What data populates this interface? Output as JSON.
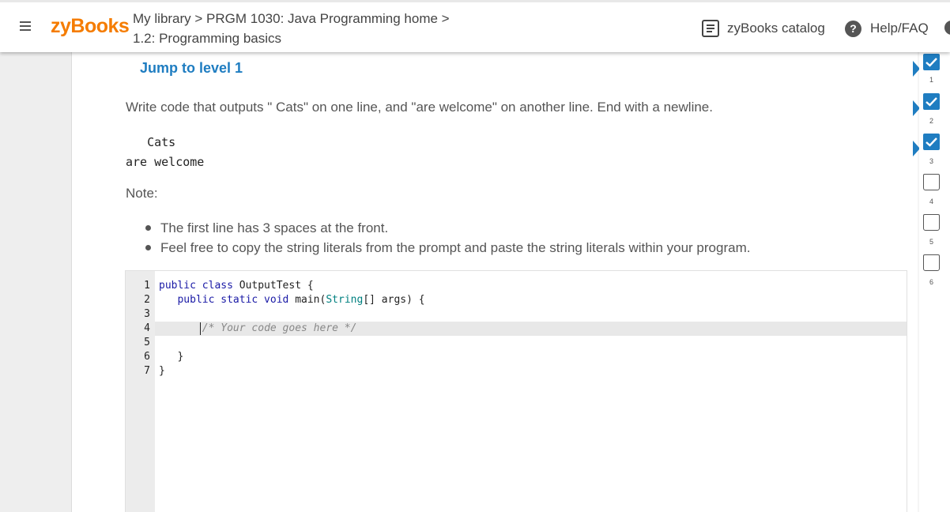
{
  "header": {
    "logo": "zyBooks",
    "breadcrumb_line1": "My library > PRGM 1030: Java Programming home >",
    "breadcrumb_line2": "1.2: Programming basics",
    "catalog_label": "zyBooks catalog",
    "help_label": "Help/FAQ",
    "help_icon_glyph": "?"
  },
  "activity": {
    "jump_link": "Jump to level 1",
    "prompt": "Write code that outputs \"   Cats\" on one line, and \"are welcome\" on another line. End with a newline.",
    "sample_output": "   Cats\nare welcome",
    "note_label": "Note:",
    "notes": [
      "The first line has 3 spaces at the front.",
      "Feel free to copy the string literals from the prompt and paste the string literals within your program."
    ]
  },
  "editor": {
    "line_numbers": [
      "1",
      "2",
      "3",
      "4",
      "5",
      "6",
      "7"
    ],
    "line1_kw": "public class",
    "line1_rest": " OutputTest {",
    "line2_kw": "public static void",
    "line2_mid": " main(",
    "line2_type": "String",
    "line2_rest": "[] args) {",
    "line4_comment": "/* Your code goes here */",
    "line6": "   }",
    "line7": "}"
  },
  "levels": [
    {
      "number": "1",
      "completed": true
    },
    {
      "number": "2",
      "completed": true
    },
    {
      "number": "3",
      "completed": true
    },
    {
      "number": "4",
      "completed": false
    },
    {
      "number": "5",
      "completed": false
    },
    {
      "number": "6",
      "completed": false
    }
  ],
  "colors": {
    "brand": "#f57c00",
    "accent": "#1f7dc1",
    "level_done": "#1f7dc1"
  }
}
